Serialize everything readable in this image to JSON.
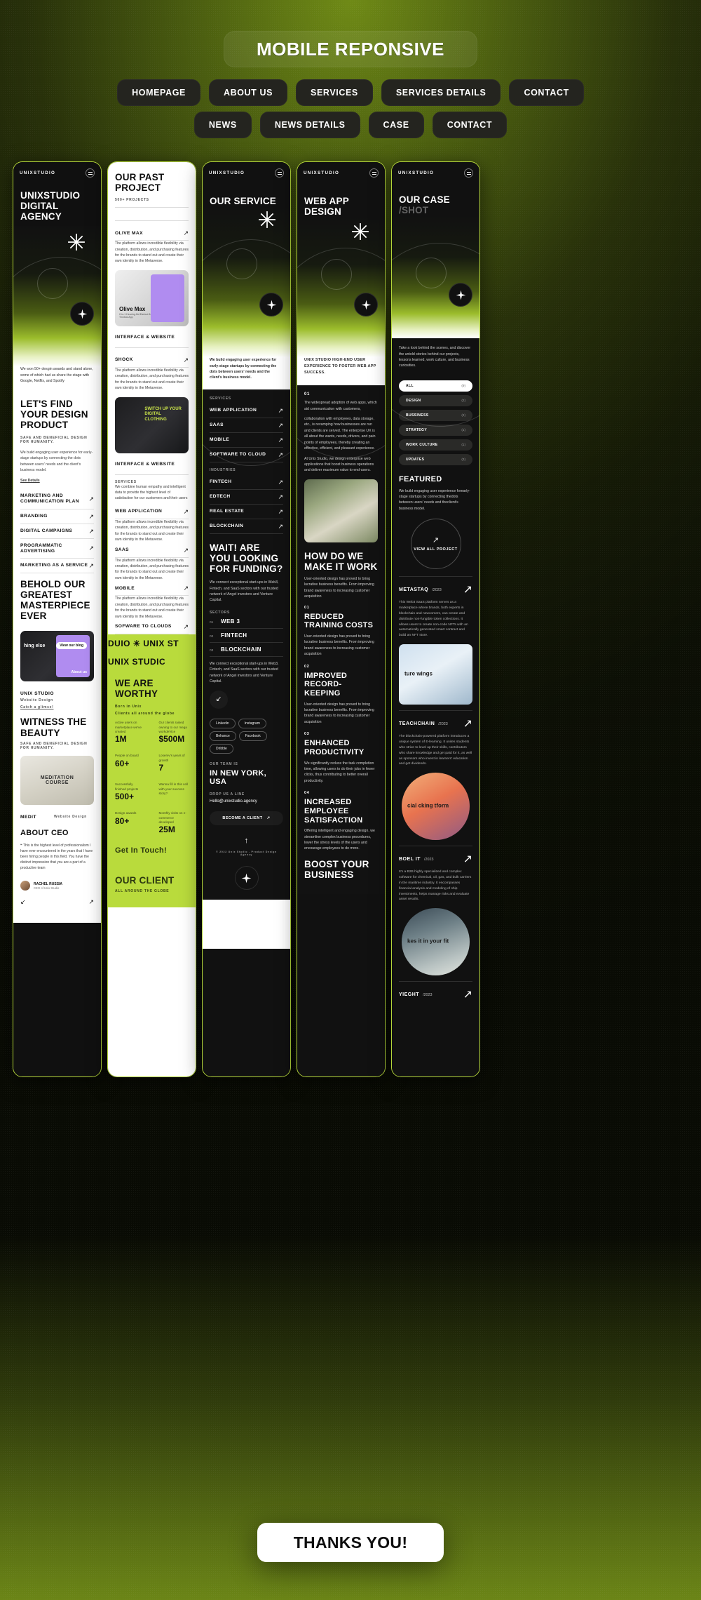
{
  "header": {
    "title": "MOBILE REPONSIVE",
    "nav_row_1": [
      "HOMEPAGE",
      "ABOUT US",
      "SERVICES",
      "SERVICES DETAILS",
      "CONTACT"
    ],
    "nav_row_2": [
      "NEWS",
      "NEWS DETAILS",
      "CASE",
      "CONTACT"
    ]
  },
  "thanks": {
    "label": "THANKS YOU!"
  },
  "screens": [
    {
      "id": "homepage",
      "brand": "UNIXSTUDIO",
      "title": "UNIXSTUDIO DIGITAL AGENCY",
      "hero_caption": "We won 50+ desgin awards and stand alone, some of which had us share the stage with Google, Netflix, and Spotify",
      "section_title": "LET'S FIND YOUR DESIGN PRODUCT",
      "section_sub": "SAFE AND BENEFICIAL DESIGN FOR HUMANITY.",
      "section_body": "We build engaging user experience for early-stage startups by connecting the dots between users' needs and the client's business model.",
      "link_more": "See Details",
      "services": [
        "MARKETING AND COMMUNICATION PLAN",
        "BRANDING",
        "DIGITAL CAMPAIGNS",
        "PROGRAMMATIC ADVERTISING",
        "MARKETING AS A SERVICE"
      ],
      "behold_title": "BEHOLD OUR GREATEST MASTERPIECE EVER",
      "card_overlay_a": "hing else",
      "card_overlay_b": "View our blog",
      "card_overlay_c": "About us",
      "work_name": "UNIX STUDIO",
      "work_type": "Website Design",
      "work_link": "Catch a glimse!",
      "witness_title": "WITNESS THE BEAUTY",
      "witness_sub": "SAFE AND BENEFICIAL DESIGN FOR HUMANITY.",
      "media_title": "MEDITATION COURSE",
      "media_name": "MEDIT",
      "media_type": "Website Design",
      "about_ceo": "ABOUT CEO",
      "quote": "This is the highest level of professionalism I have ever encountered in the years that I have been hiring people in this field. You have the distinct impression that you are a part of a productive team",
      "person_name": "RACHEL RUSSIA",
      "person_role": "CEO of Unix Studio"
    },
    {
      "id": "past-project",
      "title": "OUR PAST PROJECT",
      "counter": "500+ PROJECTS",
      "projects": [
        {
          "name": "OLIVE MAX",
          "desc": "The platform allows incredible flexibility via creation, distribution, and purchasing features for the brands to stand out and create their own identity in the Metaverse.",
          "tag": "INTERFACE & WEBSITE"
        },
        {
          "name": "SHOCK",
          "desc": "The platform allows incredible flexibility via creation, distribution, and purchasing features for the brands to stand out and create their own identity in the Metaverse.",
          "tag": "INTERFACE & WEBSITE"
        }
      ],
      "card_title_1": "Olive Max",
      "card_sub_1": "2-in-1 Hearing Aid Earbud & Tinnitus App",
      "card_title_2": "SWITCH UP YOUR DIGITAL CLOTHING",
      "services_label": "SERVICES",
      "services_intro": "We combine human empathy and intelligent data to provide the highest level of satisfaction for our customers and their users",
      "services": [
        {
          "name": "WEB APPLICATION",
          "desc": "The platform allows incredible flexibility via creation, distribution, and purchasing features for the brands to stand out and create their own identity in the Metaverse."
        },
        {
          "name": "SAAS",
          "desc": "The platform allows incredible flexibility via creation, distribution, and purchasing features for the brands to stand out and create their own identity in the Metaverse."
        },
        {
          "name": "MOBILE",
          "desc": "The platform allows incredible flexibility via creation, distribution, and purchasing features for the brands to stand out and create their own identity in the Metaverse."
        },
        {
          "name": "SOFWARE TO CLOUDS",
          "desc": ""
        }
      ],
      "marquee": "DUIO ✳ UNIX ST",
      "marquee2": "UNIX STUDIC",
      "worthy_title": "WE ARE WORTHY",
      "worthy_sub_1": "Born in Unix",
      "worthy_sub_2": "Clients all around the globe",
      "stats": [
        {
          "k": "Active users on marketplace we've created",
          "v": "1M"
        },
        {
          "k": "Our clients raised owning to our mega workdeVice",
          "v": "$500M"
        },
        {
          "k": "People on board",
          "v": "60+"
        },
        {
          "k": "Loserev's years of growth",
          "v": "7"
        },
        {
          "k": "Successfully finished projects",
          "v": "500+"
        },
        {
          "k": "Wanna fill in this cell with your success story?",
          "v": ""
        },
        {
          "k": "Design awards",
          "v": "80+"
        },
        {
          "k": "Monthly visits on e-commerce developed",
          "v": "25M"
        }
      ],
      "cta_text": "Get In Touch!",
      "client_title": "OUR CLIENT",
      "client_sub": "ALL AROUND THE GLOBE"
    },
    {
      "id": "our-service",
      "brand": "UNIXSTUDIO",
      "title": "OUR SERVICE",
      "hero_caption": "We build engaging user experience for early-stage startups by connecting the dots between users' needs and the client's business model.",
      "services_label": "SERVICES",
      "services": [
        "WEB APPLICATION",
        "SAAS",
        "MOBILE",
        "SOFTWARE TO CLOUD"
      ],
      "industries_label": "INDUSTRIES",
      "industries": [
        "FINTECH",
        "EDTECH",
        "REAL ESTATE",
        "BLOCKCHAIN"
      ],
      "wait_title": "WAIT! ARE YOU LOOKING FOR FUNDING?",
      "wait_body": "We connect exceptional start-ups in Web3, Fintech, and SaaS sectors with our trusted network of Angel investors and Venture Capital.",
      "sectors_label": "SECTORS",
      "sectors": [
        {
          "n": "01",
          "t": "WEB 3"
        },
        {
          "n": "02",
          "t": "FINTECH"
        },
        {
          "n": "03",
          "t": "BLOCKCHAIN"
        }
      ],
      "sectors_body": "We connect exceptional start-ups in Web3, Fintech, and SaaS sectors with our trusted network of Angel investors and Venture Capital.",
      "socials": [
        "Linkedin",
        "Instagram",
        "Behance",
        "Facebook",
        "Dribble"
      ],
      "team_label": "OUR TEAM IS",
      "team_loc": "IN NEW YORK, USA",
      "line_label": "DROP US A LINE",
      "email": "Hello@unixstudio.agency",
      "cta": "BECOME A CLIENT",
      "copyright": "© 2022 Unix Studio - Product Design Agency"
    },
    {
      "id": "web-app-design",
      "brand": "UNIXSTUDIO",
      "title": "WEB APP DESIGN",
      "hero_caption": "UNIX STUDIO HIGH-END USER EXPERIENCE TO FOSTER WEB APP SUCCESS.",
      "intro_num": "01",
      "intro_body_1": "The widespread adoption of web apps, which aid communication with customers,",
      "intro_body_2": "collaboration with employees, data storage, etc., is revamping how businesses are run and clients are served. The enterprise UX is all about the wants, needs, drivers, and pain points of employees, thereby creating an effective, efficient, and pleasant experience.",
      "intro_body_3": "At Unix Studio, we design enterprise web applications that boost business operations and deliver maximum value to end-users.",
      "how_title": "HOW DO WE MAKE IT WORK",
      "how_body": "User-oriented design has proved to bring lucrative business benefits. From improving brand awareness to increasing customer acquisition",
      "benefits": [
        {
          "n": "01",
          "t": "REDUCED TRAINING COSTS",
          "d": "User-oriented design has proved to bring lucrative business benefits. From improving brand awareness to increasing customer acquisition"
        },
        {
          "n": "02",
          "t": "IMPROVED RECORD-KEEPING",
          "d": "User-oriented design has proved to bring lucrative business benefits. From improving brand awareness to increasing customer acquisition"
        },
        {
          "n": "03",
          "t": "ENHANCED PRODUCTIVITY",
          "d": "We significantly reduce the task completion time, allowing users to do their jobs in fewer clicks, thus contributing to better overall productivity."
        },
        {
          "n": "04",
          "t": "INCREASED EMPLOYEE SATISFACTION",
          "d": "Offering intelligent and engaging design, we streamline complex business procedures, lower the stress levels of the users and encourage employees to do more."
        }
      ],
      "boost_title": "BOOST YOUR BUSINESS"
    },
    {
      "id": "our-case",
      "brand": "UNIXSTUDIO",
      "title": "OUR CASE",
      "title_sub": "/SHOT",
      "hero_caption": "Take a look behind the scenes, and discover the untold stories behind our projects, lessons learned, work culture, and business curiosities.",
      "filters": [
        {
          "label": "ALL",
          "count": "(9)",
          "active": true
        },
        {
          "label": "DESIGN",
          "count": "(2)",
          "active": false
        },
        {
          "label": "BUSSINESS",
          "count": "(2)",
          "active": false
        },
        {
          "label": "STRATEGY",
          "count": "(1)",
          "active": false
        },
        {
          "label": "WORK CULTURE",
          "count": "(1)",
          "active": false
        },
        {
          "label": "UPDATES",
          "count": "(3)",
          "active": false
        }
      ],
      "featured_label": "FEATURED",
      "featured_body": "We build engaging user experience forearly-stage startups by connecting thedots between users' needs and theclient's business model.",
      "view_all": "VIEW ALL PROJECT",
      "cases": [
        {
          "name": "METASTAQ",
          "year": "/2023",
          "desc": "This Web3 SaaS platform serves as a marketplace where brands, both experts in blockchain and newcomers, can create and distribute non-fungible token collections. It allows users to create non-code NFTs with an automatically generated smart contract and build an NFT store.",
          "img_text": "ture wings"
        },
        {
          "name": "TEACHCHAIN",
          "year": "/2023",
          "desc": "The blockchain-powered platform introduces a unique system of E-learning. It unites students who strive to level up their skills, contributors who share knowledge and get paid for it, as well as sponsors who invest in learners' education and get dividends.",
          "img_text": "cial cking tform"
        },
        {
          "name": "BOEL IT",
          "year": "/2023",
          "desc": "It's a B2B highly specialized and complex software for chemical, oil, gas, and bulk carriers in the maritime industry. It encompasses financial analysis and modeling of ship investments, helps manage risks and evaluate asset results.",
          "img_text": "kes it in your fit"
        },
        {
          "name": "YIEGHT",
          "year": "/2023",
          "desc": ""
        }
      ]
    }
  ]
}
